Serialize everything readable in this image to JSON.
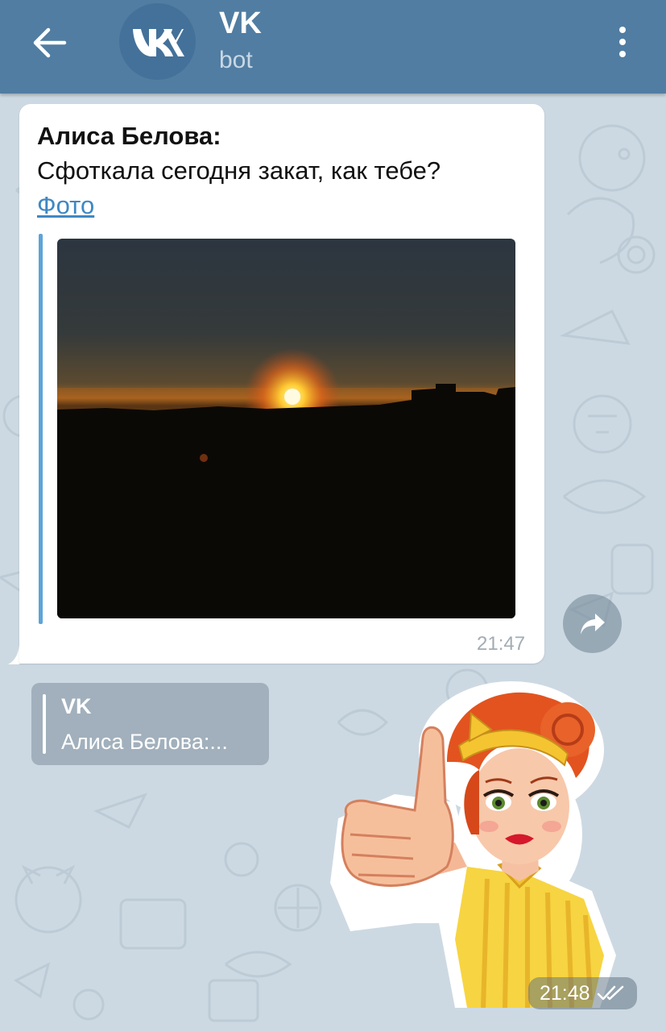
{
  "header": {
    "title": "VK",
    "subtitle": "bot",
    "avatar_logo": "VK"
  },
  "message": {
    "sender": "Алиса Белова:",
    "text": "Сфоткала сегодня закат, как тебе?",
    "link_text": "Фото",
    "time": "21:47"
  },
  "reply": {
    "name": "VK",
    "text": "Алиса Белова:..."
  },
  "sticker": {
    "time": "21:48",
    "status": "read"
  },
  "colors": {
    "header": "#517da2",
    "background": "#cdd9e2",
    "link": "#3e88c4",
    "quote_bar": "#5ea3d8"
  },
  "icons": [
    "back-arrow-icon",
    "vk-logo-icon",
    "more-vertical-icon",
    "share-icon",
    "double-check-icon"
  ]
}
